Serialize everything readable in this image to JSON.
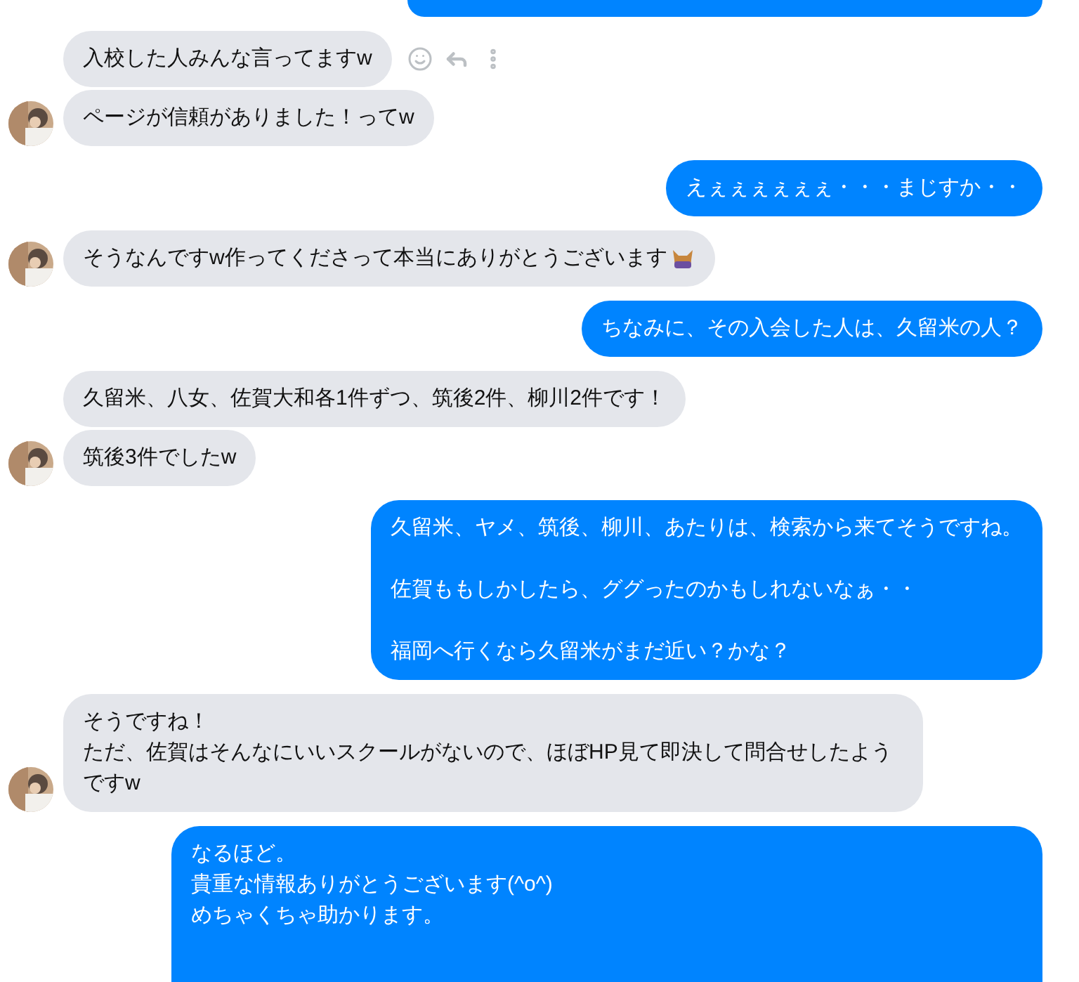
{
  "messages": [
    {
      "outgoing": true,
      "kind": "clipped"
    },
    {
      "outgoing": false,
      "kind": "text",
      "lines": [
        "入校した人みんな言ってますw"
      ],
      "avatar": false,
      "hovered": true
    },
    {
      "outgoing": false,
      "kind": "text",
      "lines": [
        "ページが信頼がありました！ってw"
      ],
      "avatar": true,
      "hovered": false
    },
    {
      "outgoing": true,
      "kind": "text",
      "lines": [
        "えぇぇぇぇぇぇ・・・まじすか・・"
      ]
    },
    {
      "outgoing": false,
      "kind": "text",
      "lines": [
        "そうなんですw作ってくださって本当にありがとうございます"
      ],
      "avatar": true,
      "hovered": false,
      "trailing_emoji": true
    },
    {
      "outgoing": true,
      "kind": "text",
      "lines": [
        "ちなみに、その入会した人は、久留米の人？"
      ]
    },
    {
      "outgoing": false,
      "kind": "text",
      "lines": [
        "久留米、八女、佐賀大和各1件ずつ、筑後2件、柳川2件です！"
      ],
      "avatar": false,
      "hovered": false
    },
    {
      "outgoing": false,
      "kind": "text",
      "lines": [
        "筑後3件でしたw"
      ],
      "avatar": true,
      "hovered": false
    },
    {
      "outgoing": true,
      "kind": "paragraphs",
      "lines": [
        "久留米、ヤメ、筑後、柳川、あたりは、検索から来てそうですね。",
        "佐賀ももしかしたら、ググったのかもしれないなぁ・・",
        "福岡へ行くなら久留米がまだ近い？かな？"
      ]
    },
    {
      "outgoing": false,
      "kind": "text",
      "lines": [
        "そうですね！",
        "ただ、佐賀はそんなにいいスクールがないので、ほぼHP見て即決して問合せしたようですw"
      ],
      "avatar": true,
      "hovered": false
    },
    {
      "outgoing": true,
      "kind": "tall",
      "lines": [
        "なるほど。",
        "貴重な情報ありがとうございます(^o^)",
        "めちゃくちゃ助かります。"
      ]
    }
  ]
}
